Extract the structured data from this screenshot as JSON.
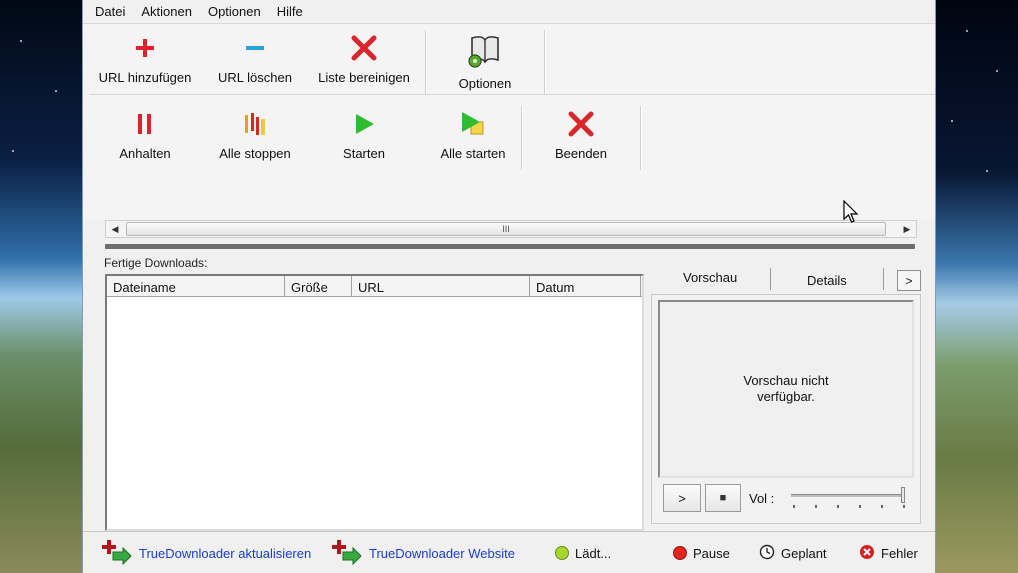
{
  "menu": [
    "Datei",
    "Aktionen",
    "Optionen",
    "Hilfe"
  ],
  "toolbar": {
    "row1": [
      {
        "label": "URL hinzufügen",
        "icon": "plus-icon"
      },
      {
        "label": "URL löschen",
        "icon": "minus-icon"
      },
      {
        "label": "Liste bereinigen",
        "icon": "red-x-icon"
      },
      {
        "label": "Optionen",
        "icon": "book-gear-icon"
      }
    ],
    "row2": [
      {
        "label": "Anhalten",
        "icon": "pause-icon"
      },
      {
        "label": "Alle stoppen",
        "icon": "stop-all-icon"
      },
      {
        "label": "Starten",
        "icon": "play-icon"
      },
      {
        "label": "Alle starten",
        "icon": "play-all-icon"
      },
      {
        "label": "Beenden",
        "icon": "red-x-icon"
      }
    ]
  },
  "scrollbar": {
    "grip": "III"
  },
  "downloads": {
    "label": "Fertige Downloads:",
    "columns": [
      "Dateiname",
      "Größe",
      "URL",
      "Datum"
    ]
  },
  "side_panel": {
    "tabs": [
      "Vorschau",
      "Details"
    ],
    "tab_scroll": ">",
    "preview_text_1": "Vorschau nicht",
    "preview_text_2": "verfügbar.",
    "play_label": ">",
    "stop_label": "■",
    "volume_label": "Vol :",
    "volume_level": 1.0
  },
  "statusbar": {
    "update_link": "TrueDownloader aktualisieren",
    "website_link": "TrueDownloader Website",
    "loading": "Lädt...",
    "pause": "Pause",
    "scheduled": "Geplant",
    "error": "Fehler"
  },
  "colors": {
    "accent_red": "#d9262b",
    "accent_blue": "#27a0d6",
    "play_green": "#2ebd2e",
    "link_blue": "#1a3ccf",
    "status_loading": "#a6d62b",
    "status_pause": "#e0261f",
    "status_error": "#d81f26"
  }
}
